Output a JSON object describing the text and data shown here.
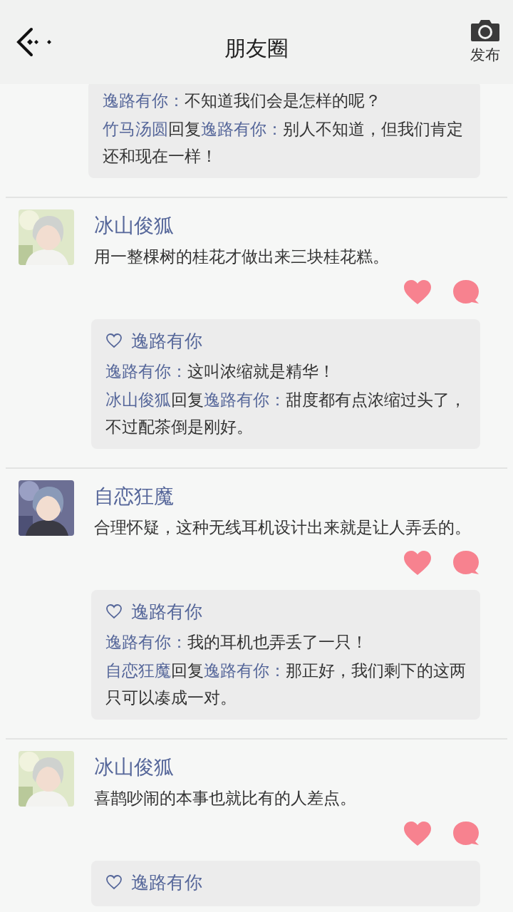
{
  "header": {
    "title": "朋友圈",
    "publish_label": "发布"
  },
  "posts": [
    {
      "comments": [
        {
          "author": "逸路有你：",
          "text": "不知道我们会是怎样的呢？"
        },
        {
          "author": "竹马汤圆",
          "reply_word": "回复",
          "reply_to": "逸路有你：",
          "text": "别人不知道，但我们肯定还和现在一样！"
        }
      ]
    },
    {
      "author": "冰山俊狐",
      "text": "用一整棵树的桂花才做出来三块桂花糕。",
      "likes": [
        "逸路有你"
      ],
      "comments": [
        {
          "author": "逸路有你：",
          "text": "这叫浓缩就是精华！"
        },
        {
          "author": "冰山俊狐",
          "reply_word": "回复",
          "reply_to": "逸路有你：",
          "text": "甜度都有点浓缩过头了，不过配茶倒是刚好。"
        }
      ]
    },
    {
      "author": "自恋狂魔",
      "text": "合理怀疑，这种无线耳机设计出来就是让人弄丢的。",
      "likes": [
        "逸路有你"
      ],
      "comments": [
        {
          "author": "逸路有你：",
          "text": "我的耳机也弄丢了一只！"
        },
        {
          "author": "自恋狂魔",
          "reply_word": "回复",
          "reply_to": "逸路有你：",
          "text": "那正好，我们剩下的这两只可以凑成一对。"
        }
      ]
    },
    {
      "author": "冰山俊狐",
      "text": "喜鹊吵闹的本事也就比有的人差点。",
      "likes": [
        "逸路有你"
      ]
    }
  ]
}
